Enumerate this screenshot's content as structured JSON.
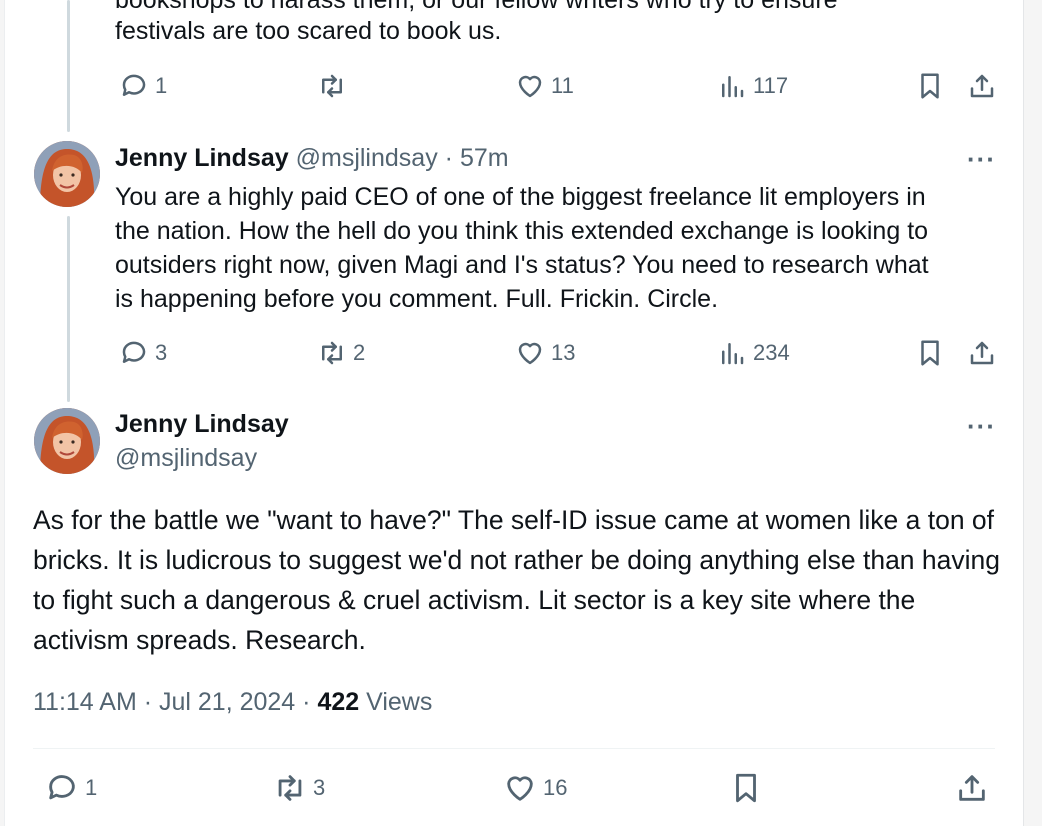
{
  "top_tweet": {
    "cut_line": "bookshops to harass them, or our fellow writers who try to ensure",
    "last_line": "festivals are too scared to book us.",
    "actions": {
      "replies": "1",
      "reposts": "",
      "likes": "11",
      "views": "117"
    }
  },
  "reply_tweet": {
    "author_name": "Jenny Lindsay",
    "handle": "@msjlindsay",
    "separator": "·",
    "time": "57m",
    "more": "···",
    "text": "You are a highly paid CEO of one of the biggest freelance lit employers in\nthe nation. How the hell do you think this extended exchange is looking to\noutsiders right now, given Magi and I's status? You need to research what\nis happening before you comment. Full. Frickin. Circle.",
    "actions": {
      "replies": "3",
      "reposts": "2",
      "likes": "13",
      "views": "234"
    }
  },
  "main_tweet": {
    "author_name": "Jenny Lindsay",
    "handle": "@msjlindsay",
    "more": "···",
    "text": "As for the battle we \"want to have?\" The self-ID issue came at women like a ton of bricks. It is ludicrous to suggest we'd not rather be doing anything else than having to fight such a dangerous & cruel activism. Lit sector is a key site where the activism spreads. Research.",
    "timestamp": "11:14 AM · Jul 21, 2024 · ",
    "views_count": "422",
    "views_label": " Views",
    "actions": {
      "replies": "1",
      "reposts": "3",
      "likes": "16"
    }
  },
  "colors": {
    "text": "#0f1419",
    "secondary": "#536471",
    "thread_line": "#cfd9de"
  }
}
